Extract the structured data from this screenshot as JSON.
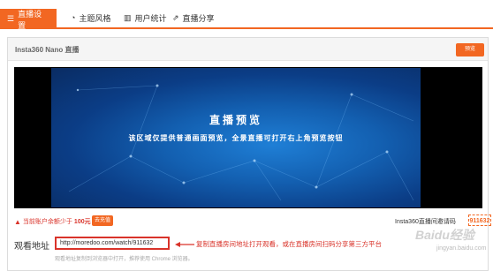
{
  "tabs": [
    {
      "label": "直播设置",
      "icon": "sliders-icon"
    },
    {
      "label": "主题风格",
      "icon": "palette-icon"
    },
    {
      "label": "用户统计",
      "icon": "bar-chart-icon"
    },
    {
      "label": "直播分享",
      "icon": "share-icon"
    }
  ],
  "panel": {
    "title": "Insta360 Nano 直播",
    "preview_button": "预览"
  },
  "video": {
    "title": "直播预览",
    "subtitle": "该区域仅提供普通画面预览，全景直播可打开右上角预览按钮"
  },
  "account": {
    "warning": "当前账户余额少于",
    "amount": "100元",
    "recharge_button": "去充值"
  },
  "room_code": {
    "label": "Insta360直播间邀请码",
    "value": "911632"
  },
  "watch": {
    "label": "观看地址",
    "url": "http://moredoo.com/watch/911632",
    "annotation": "复制直播房间地址打开观看，或在直播房间扫码分享第三方平台",
    "hint": "观看地址复制到浏览器中打开，推荐使用 Chrome 浏览器。"
  },
  "watermark": {
    "brand": "Baidu经验",
    "sub": "jingyan.baidu.com"
  },
  "colors": {
    "accent": "#f26722",
    "alert": "#d9332a"
  }
}
